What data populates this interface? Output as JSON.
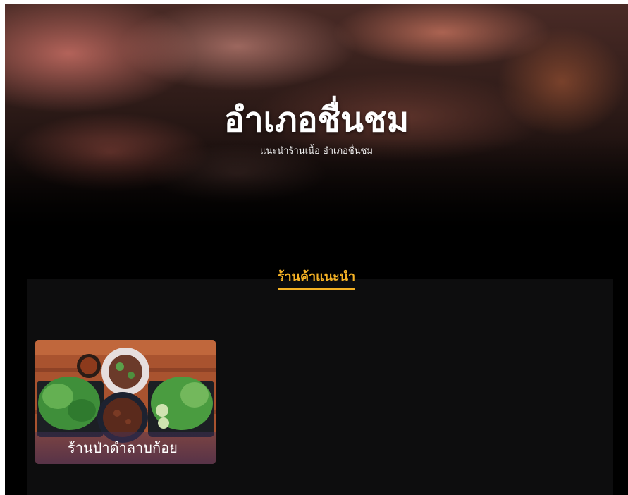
{
  "hero": {
    "title": "อำเภอชื่นชม",
    "subtitle": "แนะนำร้านเนื้อ อำเภอชื่นชม"
  },
  "recommended": {
    "heading": "ร้านค้าแนะนำ",
    "accent_color": "#f5b225",
    "shops": [
      {
        "name": "ร้านป่าดำลาบก้อย",
        "image": "food-photo"
      }
    ]
  }
}
